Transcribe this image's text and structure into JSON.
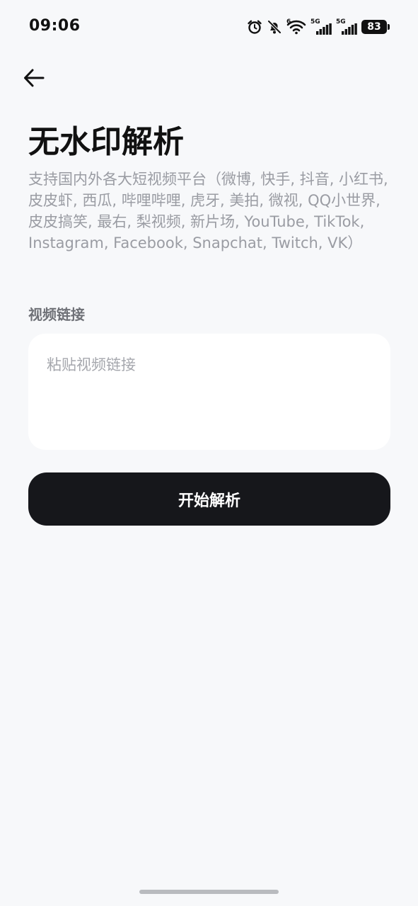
{
  "status_bar": {
    "time": "09:06",
    "network_1": "5G",
    "network_2": "5G",
    "wifi_label": "6",
    "battery": "83",
    "icons": [
      "alarm-icon",
      "bell-off-icon",
      "wifi-icon",
      "signal-icon",
      "signal-icon",
      "battery-icon"
    ]
  },
  "header": {
    "back_icon": "arrow-left-icon"
  },
  "page": {
    "title": "无水印解析",
    "description": "支持国内外各大短视频平台（微博, 快手, 抖音, 小红书, 皮皮虾, 西瓜, 哔哩哔哩, 虎牙, 美拍, 微视, QQ小世界, 皮皮搞笑, 最右, 梨视频, 新片场, YouTube, TikTok, Instagram, Facebook, Snapchat, Twitch, VK）"
  },
  "form": {
    "label": "视频链接",
    "input_value": "",
    "input_placeholder": "粘贴视频链接",
    "submit_label": "开始解析"
  },
  "colors": {
    "background": "#f7f8fa",
    "button": "#16171b",
    "description_text": "#9a9ca3",
    "input_bg": "#ffffff"
  }
}
